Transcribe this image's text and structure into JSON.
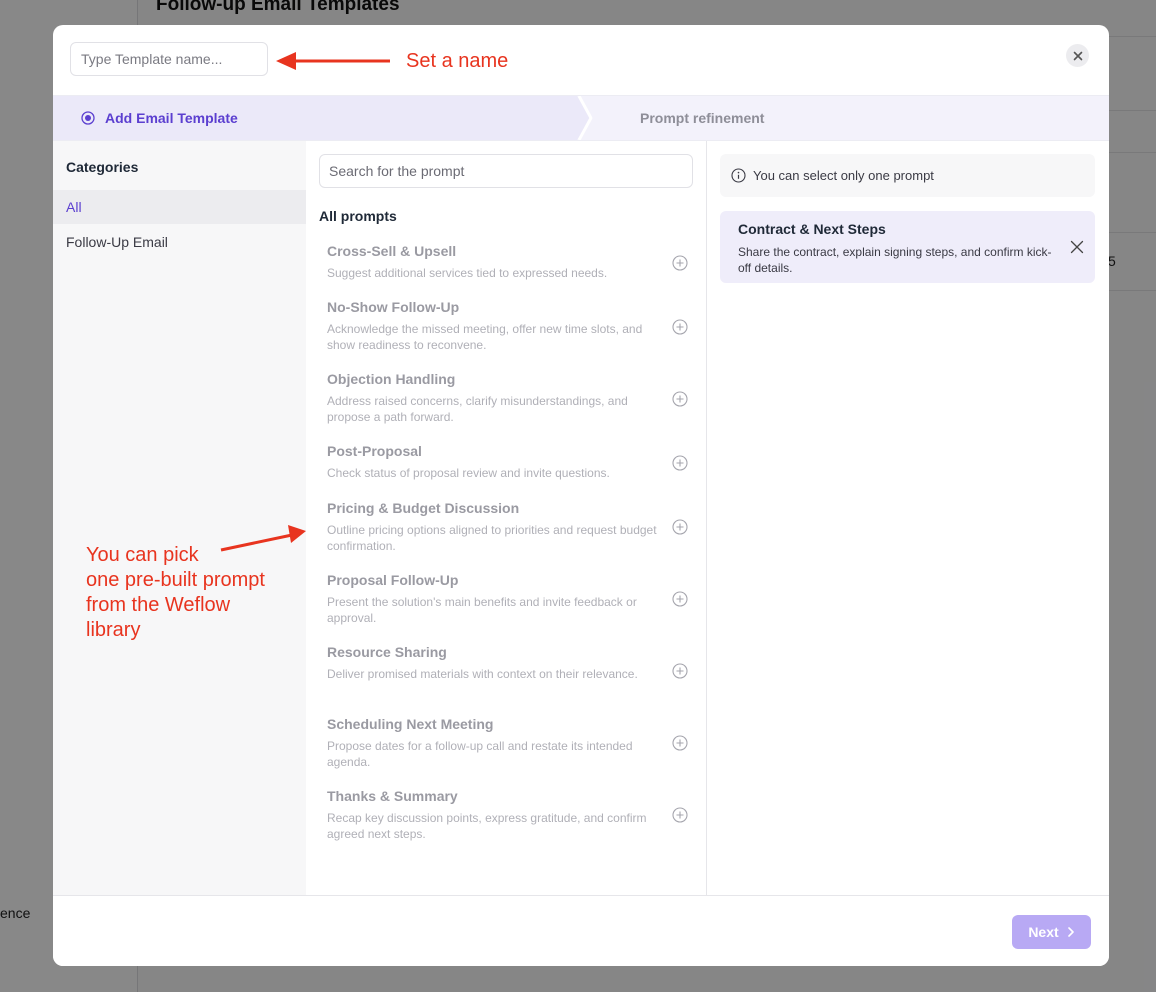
{
  "background": {
    "page_title": "Follow-up Email Templates",
    "left_text": "ence",
    "right_text": "5"
  },
  "modal": {
    "name_placeholder": "Type Template name...",
    "steps": [
      {
        "label": "Add Email Template",
        "active": true
      },
      {
        "label": "Prompt refinement",
        "active": false
      }
    ],
    "categories": {
      "title": "Categories",
      "items": [
        {
          "label": "All",
          "active": true
        },
        {
          "label": "Follow-Up Email",
          "active": false
        }
      ]
    },
    "search_placeholder": "Search for the prompt",
    "prompts_heading": "All prompts",
    "prompts": [
      {
        "title": "Cross-Sell & Upsell",
        "desc": "Suggest additional services tied to expressed needs."
      },
      {
        "title": "No-Show Follow-Up",
        "desc": "Acknowledge the missed meeting, offer new time slots, and show readiness to reconvene."
      },
      {
        "title": "Objection Handling",
        "desc": "Address raised concerns, clarify misunderstandings, and propose a path forward."
      },
      {
        "title": "Post-Proposal",
        "desc": "Check status of proposal review and invite questions."
      },
      {
        "title": "Pricing & Budget Discussion",
        "desc": "Outline pricing options aligned to priorities and request budget confirmation."
      },
      {
        "title": "Proposal Follow-Up",
        "desc": "Present the solution's main benefits and invite feedback or approval."
      },
      {
        "title": "Resource Sharing",
        "desc": "Deliver promised materials with context on their relevance."
      },
      {
        "title": "Scheduling Next Meeting",
        "desc": "Propose dates for a follow-up call and restate its intended agenda."
      },
      {
        "title": "Thanks & Summary",
        "desc": "Recap key discussion points, express gratitude, and confirm agreed next steps."
      }
    ],
    "info_text": "You can select only one prompt",
    "selected": {
      "title": "Contract & Next Steps",
      "desc": "Share the contract, explain signing steps, and confirm kick-off details."
    },
    "next_label": "Next"
  },
  "annotations": {
    "set_name": "Set a name",
    "pick_prompt": "You can pick\none pre-built prompt\nfrom the Weflow\nlibrary"
  },
  "colors": {
    "accent": "#5b3fd0",
    "annotation": "#e8341f",
    "next_button": "#b8a9f4"
  },
  "icons": {
    "close": "close-icon",
    "step_radio": "radio-selected-icon",
    "add": "plus-circle-icon",
    "info": "info-icon",
    "remove": "x-icon",
    "next": "chevron-right-icon"
  }
}
